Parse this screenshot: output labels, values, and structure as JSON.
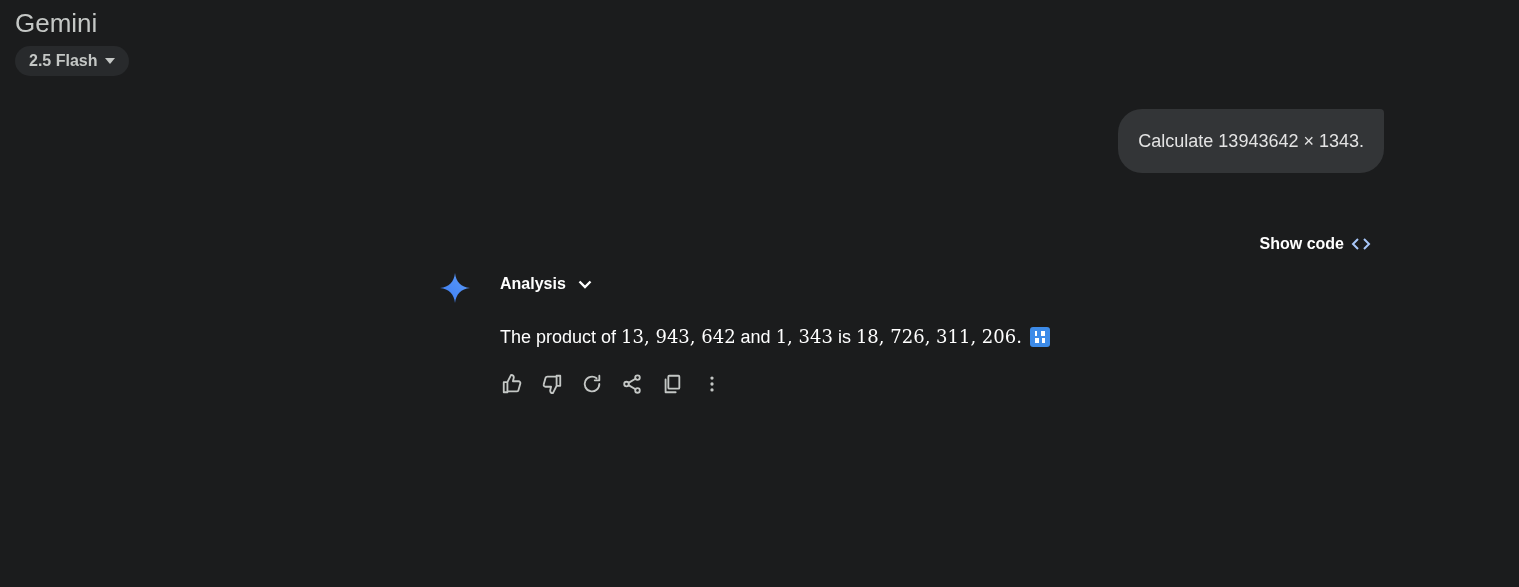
{
  "app": {
    "title": "Gemini",
    "model": "2.5 Flash"
  },
  "user_message": {
    "text": "Calculate 13943642 × 1343."
  },
  "show_code": {
    "label": "Show code"
  },
  "response": {
    "section": {
      "label": "Analysis",
      "expanded": false
    },
    "answer": [
      {
        "kind": "text",
        "text": "The product of "
      },
      {
        "kind": "math",
        "text": "13, 943, 642"
      },
      {
        "kind": "text",
        "text": " and "
      },
      {
        "kind": "math",
        "text": "1, 343"
      },
      {
        "kind": "text",
        "text": " is "
      },
      {
        "kind": "math",
        "text": "18, 726, 311, 206."
      }
    ],
    "actions": [
      {
        "kind": "like"
      },
      {
        "kind": "dislike"
      },
      {
        "kind": "redo"
      },
      {
        "kind": "share"
      },
      {
        "kind": "copy"
      },
      {
        "kind": "more"
      }
    ]
  }
}
